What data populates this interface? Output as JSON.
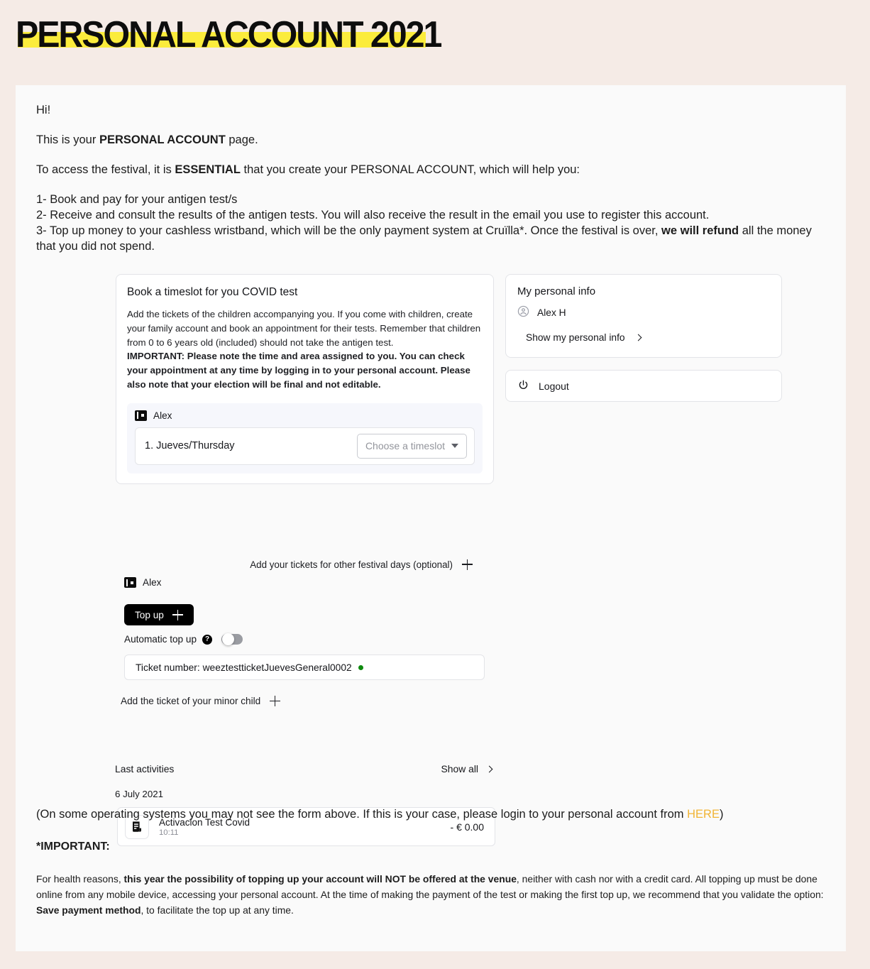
{
  "header": {
    "title": "PERSONAL ACCOUNT 2021",
    "highlight_color": "#fbec3c"
  },
  "intro": {
    "greeting": "Hi!",
    "line_personal_prefix": "This is your ",
    "line_personal_bold": "PERSONAL ACCOUNT",
    "line_personal_suffix": " page.",
    "line_access_prefix": "To access the festival, it is ",
    "line_access_bold": "ESSENTIAL",
    "line_access_suffix": " that you create your PERSONAL ACCOUNT, which will help you:",
    "item_1": "1- Book and pay for your antigen test/s",
    "item_2": "2- Receive and consult the results of the antigen tests. You will also receive the result in the email you use to register this account.",
    "item_3_prefix": "3- Top up money to your cashless wristband, which will be the only payment system at Cruïlla*. Once the festival is over, ",
    "item_3_bold": "we will refund",
    "item_3_suffix": " all the money that you did not spend."
  },
  "booking": {
    "title": "Book a timeslot for you COVID test",
    "description": "Add the tickets of the children accompanying you. If you come with children, create your family account and book an appointment for their tests. Remember that children from 0 to 6 years old (included) should not take the antigen test.",
    "important": "IMPORTANT: Please note the time and area assigned to you. You can check your appointment at any time by logging in to your personal account. Please also note that your election will be final and not editable.",
    "owner_name": "Alex",
    "timeslot_day": "1. Jueves/Thursday",
    "timeslot_placeholder": "Choose a timeslot"
  },
  "wallet": {
    "add_other_days_label": "Add your tickets for other festival days (optional)",
    "owner_name": "Alex",
    "topup_label": "Top up",
    "auto_topup_label": "Automatic top up",
    "auto_topup_state": "off",
    "ticket_number": "Ticket number: weeztestticketJuevesGeneral0002",
    "ticket_status_color": "#0e8a0e",
    "add_child_label": "Add the ticket of your minor child"
  },
  "activities": {
    "title": "Last activities",
    "show_all_label": "Show all",
    "date": "6 July 2021",
    "rows": [
      {
        "title": "Activacion Test Covid",
        "time": "10:11",
        "amount": "- € 0.00"
      }
    ]
  },
  "personal_info": {
    "title": "My personal info",
    "user_name": "Alex H",
    "show_label": "Show my personal info",
    "logout_label": "Logout"
  },
  "footer": {
    "note_prefix": "(On some operating systems you may not see the form above. If this is your case, please login to your personal account from ",
    "note_link": "HERE",
    "note_suffix": ")",
    "link_color": "#f1b434",
    "important_heading": "*IMPORTANT:",
    "body_prefix": "For health reasons, ",
    "body_bold_1": "this year the possibility of topping up your account will NOT be offered at the venue",
    "body_mid": ", neither with cash nor with a credit card. All topping up must be done online from any mobile device, accessing your personal account. At the time of making the payment of the test or making the first top up, we recommend that you validate the option: ",
    "body_bold_2": "Save payment method",
    "body_suffix": ", to facilitate the top up at any time."
  }
}
